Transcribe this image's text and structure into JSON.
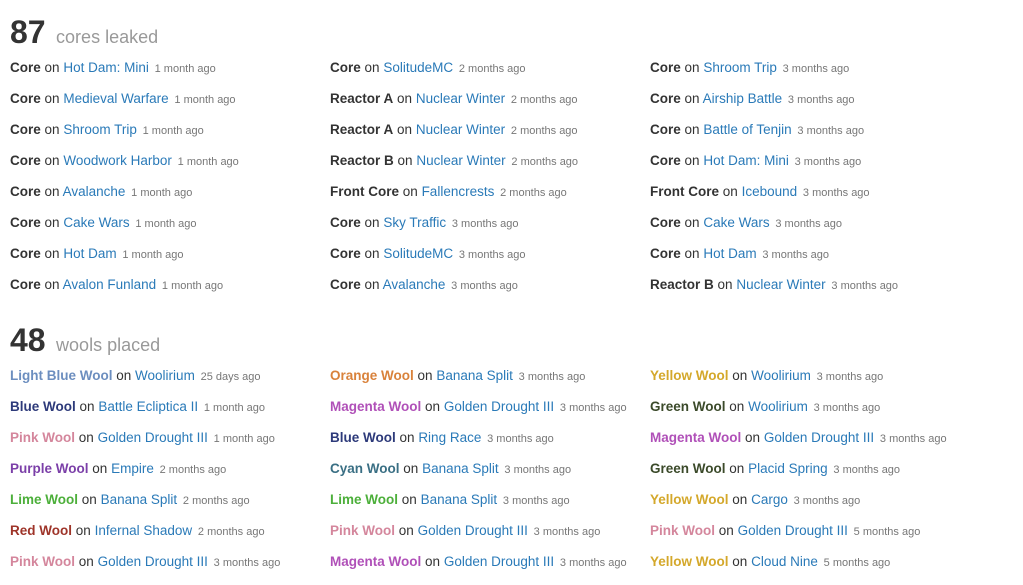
{
  "cores": {
    "count": "87",
    "label": "cores leaked",
    "columns": [
      [
        {
          "objective": "Core",
          "on": "on",
          "map": "Hot Dam: Mini",
          "time": "1 month ago"
        },
        {
          "objective": "Core",
          "on": "on",
          "map": "Medieval Warfare",
          "time": "1 month ago"
        },
        {
          "objective": "Core",
          "on": "on",
          "map": "Shroom Trip",
          "time": "1 month ago"
        },
        {
          "objective": "Core",
          "on": "on",
          "map": "Woodwork Harbor",
          "time": "1 month ago"
        },
        {
          "objective": "Core",
          "on": "on",
          "map": "Avalanche",
          "time": "1 month ago"
        },
        {
          "objective": "Core",
          "on": "on",
          "map": "Cake Wars",
          "time": "1 month ago"
        },
        {
          "objective": "Core",
          "on": "on",
          "map": "Hot Dam",
          "time": "1 month ago"
        },
        {
          "objective": "Core",
          "on": "on",
          "map": "Avalon Funland",
          "time": "1 month ago"
        }
      ],
      [
        {
          "objective": "Core",
          "on": "on",
          "map": "SolitudeMC",
          "time": "2 months ago"
        },
        {
          "objective": "Reactor A",
          "on": "on",
          "map": "Nuclear Winter",
          "time": "2 months ago"
        },
        {
          "objective": "Reactor A",
          "on": "on",
          "map": "Nuclear Winter",
          "time": "2 months ago"
        },
        {
          "objective": "Reactor B",
          "on": "on",
          "map": "Nuclear Winter",
          "time": "2 months ago"
        },
        {
          "objective": "Front Core",
          "on": "on",
          "map": "Fallencrests",
          "time": "2 months ago"
        },
        {
          "objective": "Core",
          "on": "on",
          "map": "Sky Traffic",
          "time": "3 months ago"
        },
        {
          "objective": "Core",
          "on": "on",
          "map": "SolitudeMC",
          "time": "3 months ago"
        },
        {
          "objective": "Core",
          "on": "on",
          "map": "Avalanche",
          "time": "3 months ago"
        }
      ],
      [
        {
          "objective": "Core",
          "on": "on",
          "map": "Shroom Trip",
          "time": "3 months ago"
        },
        {
          "objective": "Core",
          "on": "on",
          "map": "Airship Battle",
          "time": "3 months ago"
        },
        {
          "objective": "Core",
          "on": "on",
          "map": "Battle of Tenjin",
          "time": "3 months ago"
        },
        {
          "objective": "Core",
          "on": "on",
          "map": "Hot Dam: Mini",
          "time": "3 months ago"
        },
        {
          "objective": "Front Core",
          "on": "on",
          "map": "Icebound",
          "time": "3 months ago"
        },
        {
          "objective": "Core",
          "on": "on",
          "map": "Cake Wars",
          "time": "3 months ago"
        },
        {
          "objective": "Core",
          "on": "on",
          "map": "Hot Dam",
          "time": "3 months ago"
        },
        {
          "objective": "Reactor B",
          "on": "on",
          "map": "Nuclear Winter",
          "time": "3 months ago"
        }
      ]
    ]
  },
  "wools": {
    "count": "48",
    "label": "wools placed",
    "columns": [
      [
        {
          "objective": "Light Blue Wool",
          "color": "#6c8ebf",
          "on": "on",
          "map": "Woolirium",
          "time": "25 days ago"
        },
        {
          "objective": "Blue Wool",
          "color": "#2d3a7a",
          "on": "on",
          "map": "Battle Ecliptica II",
          "time": "1 month ago"
        },
        {
          "objective": "Pink Wool",
          "color": "#d4869c",
          "on": "on",
          "map": "Golden Drought III",
          "time": "1 month ago"
        },
        {
          "objective": "Purple Wool",
          "color": "#7b3fa8",
          "on": "on",
          "map": "Empire",
          "time": "2 months ago"
        },
        {
          "objective": "Lime Wool",
          "color": "#4caf3a",
          "on": "on",
          "map": "Banana Split",
          "time": "2 months ago"
        },
        {
          "objective": "Red Wool",
          "color": "#9e3429",
          "on": "on",
          "map": "Infernal Shadow",
          "time": "2 months ago"
        },
        {
          "objective": "Pink Wool",
          "color": "#d4869c",
          "on": "on",
          "map": "Golden Drought III",
          "time": "3 months ago"
        }
      ],
      [
        {
          "objective": "Orange Wool",
          "color": "#d9823b",
          "on": "on",
          "map": "Banana Split",
          "time": "3 months ago"
        },
        {
          "objective": "Magenta Wool",
          "color": "#b050b8",
          "on": "on",
          "map": "Golden Drought III",
          "time": "3 months ago"
        },
        {
          "objective": "Blue Wool",
          "color": "#2d3a7a",
          "on": "on",
          "map": "Ring Race",
          "time": "3 months ago"
        },
        {
          "objective": "Cyan Wool",
          "color": "#3a6f84",
          "on": "on",
          "map": "Banana Split",
          "time": "3 months ago"
        },
        {
          "objective": "Lime Wool",
          "color": "#4caf3a",
          "on": "on",
          "map": "Banana Split",
          "time": "3 months ago"
        },
        {
          "objective": "Pink Wool",
          "color": "#d4869c",
          "on": "on",
          "map": "Golden Drought III",
          "time": "3 months ago"
        },
        {
          "objective": "Magenta Wool",
          "color": "#b050b8",
          "on": "on",
          "map": "Golden Drought III",
          "time": "3 months ago"
        }
      ],
      [
        {
          "objective": "Yellow Wool",
          "color": "#d4a82b",
          "on": "on",
          "map": "Woolirium",
          "time": "3 months ago"
        },
        {
          "objective": "Green Wool",
          "color": "#3b4a2a",
          "on": "on",
          "map": "Woolirium",
          "time": "3 months ago"
        },
        {
          "objective": "Magenta Wool",
          "color": "#b050b8",
          "on": "on",
          "map": "Golden Drought III",
          "time": "3 months ago"
        },
        {
          "objective": "Green Wool",
          "color": "#3b4a2a",
          "on": "on",
          "map": "Placid Spring",
          "time": "3 months ago"
        },
        {
          "objective": "Yellow Wool",
          "color": "#d4a82b",
          "on": "on",
          "map": "Cargo",
          "time": "3 months ago"
        },
        {
          "objective": "Pink Wool",
          "color": "#d4869c",
          "on": "on",
          "map": "Golden Drought III",
          "time": "5 months ago"
        },
        {
          "objective": "Yellow Wool",
          "color": "#d4a82b",
          "on": "on",
          "map": "Cloud Nine",
          "time": "5 months ago"
        }
      ]
    ]
  },
  "theme": {
    "link_color": "#2a7ab8",
    "muted_color": "#999999",
    "text_color": "#333333"
  }
}
